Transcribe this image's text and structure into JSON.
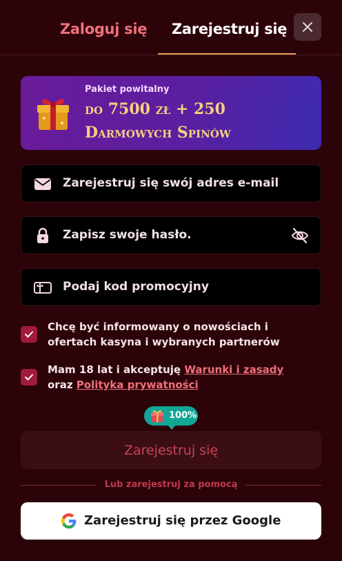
{
  "tabs": {
    "login": "Zaloguj się",
    "register": "Zarejestruj się"
  },
  "promo": {
    "subtitle": "Pakiet powitalny",
    "line1": "do 7500 zł + 250",
    "line2": "Darmowych Spinów"
  },
  "fields": {
    "email_placeholder": "Zarejestruj się swój adres e-mail",
    "password_placeholder": "Zapisz swoje hasło.",
    "promo_placeholder": "Podaj kod promocyjny"
  },
  "checkboxes": {
    "newsletter_text": "Chcę być informowany o nowościach i ofertach kasyna i wybranych partnerów",
    "newsletter_checked": true,
    "terms_prefix": "Mam 18 lat i akceptuję ",
    "terms_link": "Warunki i zasady",
    "terms_mid": " oraz ",
    "privacy_link": "Polityka prywatności",
    "terms_checked": true
  },
  "badge": {
    "text": "100%",
    "icon": "gift-icon"
  },
  "submit_label": "Zarejestruj się",
  "divider_text": "Lub zarejestruj za pomocą",
  "google_label": "Zarejestruj się przez Google",
  "colors": {
    "background": "#2c0309",
    "accent": "#f0707a",
    "checkbox": "#a11a3a",
    "badge": "#13a596",
    "promo_gold": "#f8cf7e"
  }
}
